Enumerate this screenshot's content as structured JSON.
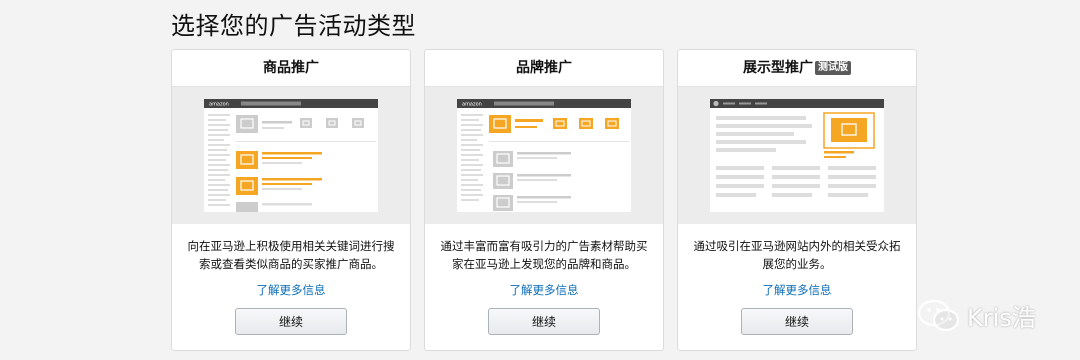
{
  "page": {
    "title": "选择您的广告活动类型"
  },
  "cards": [
    {
      "title": "商品推广",
      "description": "向在亚马逊上积极使用相关关键词进行搜索或查看类似商品的买家推广商品。",
      "learn_more": "了解更多信息",
      "button": "继续",
      "preview_header_logo": "amazon"
    },
    {
      "title": "品牌推广",
      "description": "通过丰富而富有吸引力的广告素材帮助买家在亚马逊上发现您的品牌和商品。",
      "learn_more": "了解更多信息",
      "button": "继续",
      "preview_header_logo": "amazon"
    },
    {
      "title": "展示型推广",
      "badge": "测试版",
      "description": "通过吸引在亚马逊网站内外的相关受众拓展您的业务。",
      "learn_more": "了解更多信息",
      "button": "继续"
    }
  ],
  "watermark": {
    "text": "Kris浩",
    "icon": "wechat-icon"
  },
  "colors": {
    "accent_orange": "#f5a623",
    "link": "#0b6db7",
    "header_dark": "#444444"
  }
}
